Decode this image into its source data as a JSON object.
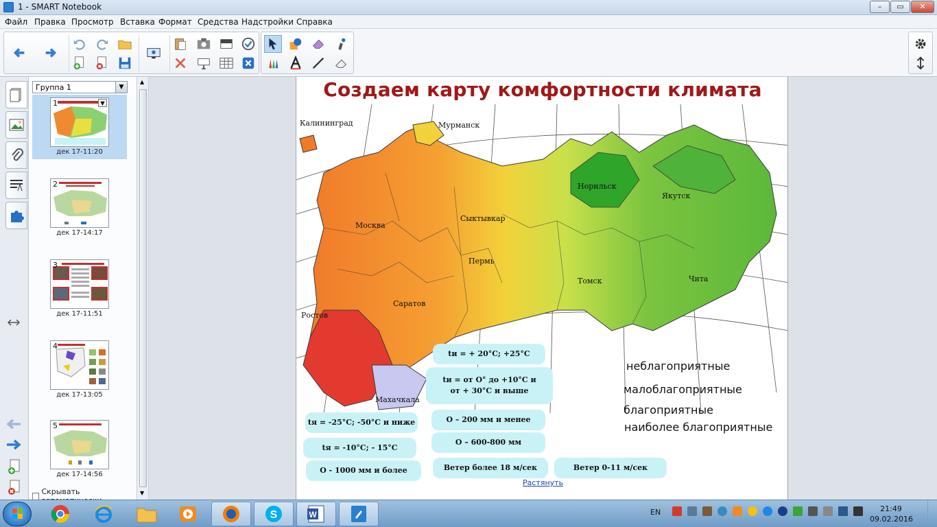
{
  "window": {
    "title": "1 - SMART Notebook",
    "min": "–",
    "max": "▭",
    "close": "✕"
  },
  "menu": [
    "Файл",
    "Правка",
    "Просмотр",
    "Вставка",
    "Формат",
    "Средства",
    "Надстройки",
    "Справка"
  ],
  "sorter": {
    "group": "Группа 1",
    "slides": [
      {
        "num": "1",
        "time": "дек 17-11:20"
      },
      {
        "num": "2",
        "time": "дек 17-14:17"
      },
      {
        "num": "3",
        "time": "дек 17-11:51"
      },
      {
        "num": "4",
        "time": "дек 17-13:05"
      },
      {
        "num": "5",
        "time": "дек 17-14:56"
      }
    ],
    "autohide": "Скрывать автоматически"
  },
  "page": {
    "title": "Создаем карту комфортности климата",
    "cities": [
      "Калининград",
      "Мурманск",
      "Москва",
      "Сыктывкар",
      "Норильск",
      "Якутск",
      "Пермь",
      "Томск",
      "Чита",
      "Саратов",
      "Ростов",
      "Махачкала"
    ],
    "bubbles": [
      "tи = + 20°С; +25°С",
      "tи = от О° до +10°С и от + 30°С и выше",
      "tя = -25°С; -50°С и ниже",
      "О – 200 мм и менее",
      "tя = -10°С; - 15°С",
      "О – 600-800 мм",
      "О - 1000 мм и более",
      "Ветер более 18 м/сек",
      "Ветер 0-11 м/сек"
    ],
    "legend": [
      "неблагоприятные",
      "малоблагоприятные",
      "благоприятные",
      "наиболее благоприятные"
    ],
    "stretch": "Растянуть"
  },
  "taskbar": {
    "lang": "EN",
    "time": "21:49",
    "date": "09.02.2016"
  },
  "colors": {
    "title": "#a01818",
    "bubble": "#c9f2f6",
    "selected_slide": "#bcd9f4"
  }
}
